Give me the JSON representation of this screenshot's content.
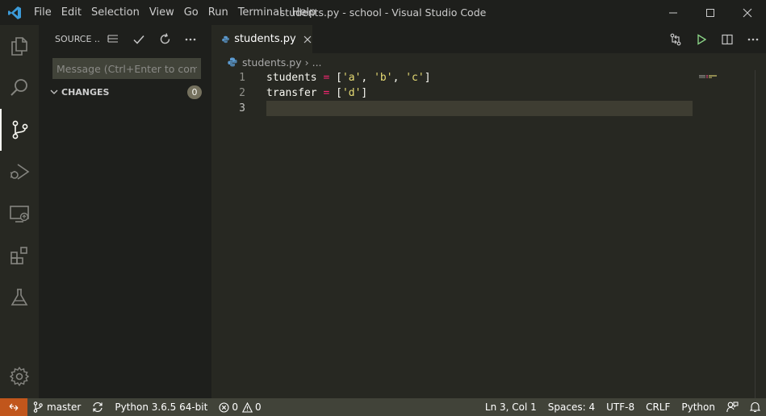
{
  "window": {
    "title": "students.py - school - Visual Studio Code"
  },
  "menu": [
    "File",
    "Edit",
    "Selection",
    "View",
    "Go",
    "Run",
    "Terminal",
    "Help"
  ],
  "activity_bar": {
    "items": [
      "explorer-icon",
      "search-icon",
      "source-control-icon",
      "run-debug-icon",
      "remote-explorer-icon",
      "extensions-icon",
      "testing-flask-icon"
    ],
    "active": "source-control-icon",
    "bottom": "settings-gear-icon"
  },
  "sidebar": {
    "title": "SOURCE ...",
    "commit_placeholder": "Message (Ctrl+Enter to com...",
    "changes_label": "CHANGES",
    "changes_count": "0"
  },
  "editor": {
    "tab_label": "students.py",
    "breadcrumb_file": "students.py",
    "breadcrumb_sep": "›",
    "breadcrumb_more": "...",
    "lines": [
      {
        "num": "1",
        "tokens": [
          {
            "t": "students ",
            "c": ""
          },
          {
            "t": "=",
            "c": "op"
          },
          {
            "t": " [",
            "c": ""
          },
          {
            "t": "'a'",
            "c": "str"
          },
          {
            "t": ", ",
            "c": ""
          },
          {
            "t": "'b'",
            "c": "str"
          },
          {
            "t": ", ",
            "c": ""
          },
          {
            "t": "'c'",
            "c": "str"
          },
          {
            "t": "]",
            "c": ""
          }
        ]
      },
      {
        "num": "2",
        "tokens": [
          {
            "t": "transfer ",
            "c": ""
          },
          {
            "t": "=",
            "c": "op"
          },
          {
            "t": " [",
            "c": ""
          },
          {
            "t": "'d'",
            "c": "str"
          },
          {
            "t": "]",
            "c": ""
          }
        ]
      },
      {
        "num": "3",
        "tokens": []
      }
    ],
    "current_line": "3"
  },
  "statusbar": {
    "branch": "master",
    "interpreter": "Python 3.6.5 64-bit",
    "errors": "0",
    "warnings": "0",
    "cursor": "Ln 3, Col 1",
    "spaces": "Spaces: 4",
    "encoding": "UTF-8",
    "eol": "CRLF",
    "language": "Python"
  },
  "colors": {
    "accent": "#c1561c",
    "background": "#272822",
    "sidebar": "#1e1f1c",
    "statusbar": "#414339",
    "string": "#e6db74",
    "operator": "#f92672"
  }
}
